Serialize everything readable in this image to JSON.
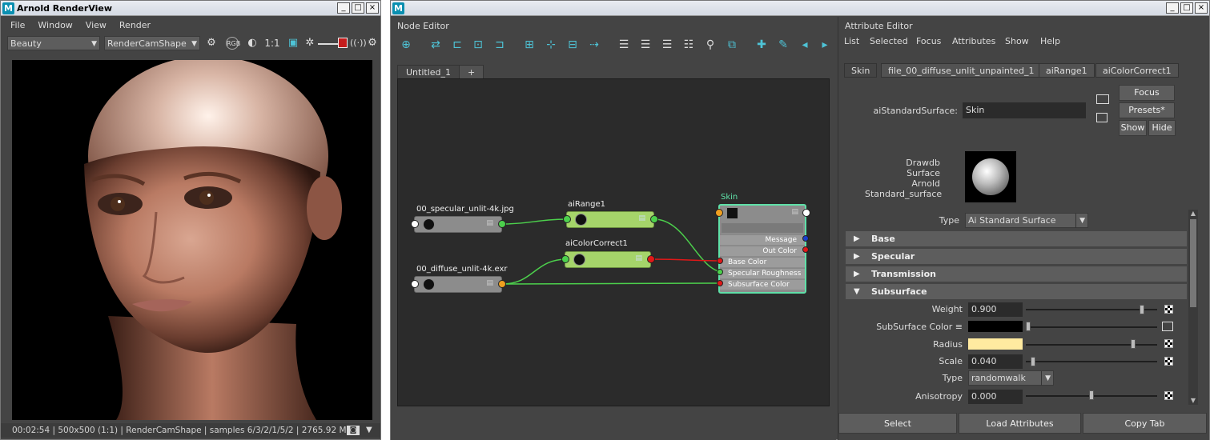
{
  "render_view": {
    "title": "Arnold RenderView",
    "menus": [
      "File",
      "Window",
      "View",
      "Render"
    ],
    "aov_select": "Beauty",
    "camera_select": "RenderCamShape",
    "ratio_label": "1:1",
    "status": "00:02:54 | 500x500 (1:1) | RenderCamShape  | samples 6/3/2/1/5/2 | 2765.92 MB"
  },
  "maya_window": {
    "node_editor": {
      "panel_title": "Node Editor",
      "tabs": [
        "Untitled_1",
        "+"
      ],
      "nodes": {
        "specular": {
          "label": "00_specular_unlit-4k.jpg"
        },
        "diffuse": {
          "label": "00_diffuse_unlit-4k.exr"
        },
        "range": {
          "label": "aiRange1"
        },
        "colorcorrect": {
          "label": "aiColorCorrect1"
        },
        "skin": {
          "label": "Skin",
          "ports": [
            "Message",
            "Out Color",
            "Base Color",
            "Specular Roughness",
            "Subsurface Color"
          ]
        }
      }
    },
    "attribute_editor": {
      "panel_title": "Attribute Editor",
      "menus": [
        "List",
        "Selected",
        "Focus",
        "Attributes",
        "Show",
        "Help"
      ],
      "tabs": [
        "Skin",
        "file_00_diffuse_unlit_unpainted_1",
        "aiRange1",
        "aiColorCorrect1"
      ],
      "node_type_label": "aiStandardSurface:",
      "node_name": "Skin",
      "buttons": {
        "focus": "Focus",
        "presets": "Presets*",
        "show": "Show",
        "hide": "Hide"
      },
      "swatch_label_lines": [
        "Drawdb",
        "Surface",
        "Arnold",
        "Standard_surface"
      ],
      "type_label": "Type",
      "type_value": "Ai Standard Surface",
      "sections": [
        "Base",
        "Specular",
        "Transmission",
        "Subsurface"
      ],
      "subsurface": {
        "weight": {
          "label": "Weight",
          "value": "0.900",
          "slider": 0.9
        },
        "color": {
          "label": "SubSurface Color ≡",
          "value_color": "#000000",
          "slider": 0.0
        },
        "radius": {
          "label": "Radius",
          "value_color": "#ffeaa0",
          "slider": 0.83
        },
        "scale": {
          "label": "Scale",
          "value": "0.040",
          "slider": 0.04
        },
        "type": {
          "label": "Type",
          "value": "randomwalk"
        },
        "anisotropy": {
          "label": "Anisotropy",
          "value": "0.000",
          "slider": 0.5
        }
      },
      "bottom_buttons": [
        "Select",
        "Load Attributes",
        "Copy Tab"
      ]
    }
  },
  "colors": {
    "accent": "#4ec3d6",
    "node_green": "#a5d46a",
    "node_grey": "#8c8c8c",
    "wire_green": "#4cd04c",
    "wire_red": "#e01818",
    "selection": "#5fe0a8"
  }
}
